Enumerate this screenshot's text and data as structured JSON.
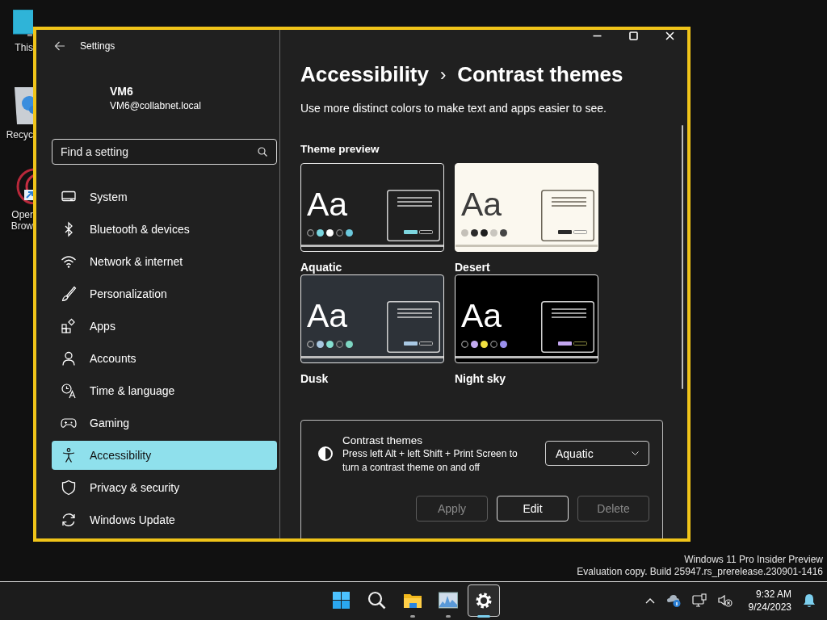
{
  "desktop_icons": [
    {
      "lines": [
        "This"
      ]
    },
    {
      "lines": [
        "Recyc"
      ]
    },
    {
      "lines": [
        "Oper",
        "Brow"
      ]
    }
  ],
  "window": {
    "title": "Settings"
  },
  "account": {
    "name": "VM6",
    "email": "VM6@collabnet.local"
  },
  "search": {
    "placeholder": "Find a setting"
  },
  "nav": [
    {
      "label": "System",
      "selected": false
    },
    {
      "label": "Bluetooth & devices",
      "selected": false
    },
    {
      "label": "Network & internet",
      "selected": false
    },
    {
      "label": "Personalization",
      "selected": false
    },
    {
      "label": "Apps",
      "selected": false
    },
    {
      "label": "Accounts",
      "selected": false
    },
    {
      "label": "Time & language",
      "selected": false
    },
    {
      "label": "Gaming",
      "selected": false
    },
    {
      "label": "Accessibility",
      "selected": true
    },
    {
      "label": "Privacy & security",
      "selected": false
    },
    {
      "label": "Windows Update",
      "selected": false
    }
  ],
  "breadcrumb": {
    "parent": "Accessibility",
    "separator": "›",
    "current": "Contrast themes"
  },
  "description": "Use more distinct colors to make text and apps easier to see.",
  "theme_preview": {
    "heading": "Theme preview",
    "themes": [
      {
        "name": "Aquatic",
        "sample": "Aa",
        "color": "#202020"
      },
      {
        "name": "Desert",
        "sample": "Aa",
        "color": "#fbf8ef"
      },
      {
        "name": "Dusk",
        "sample": "Aa",
        "color": "#2d3238"
      },
      {
        "name": "Night sky",
        "sample": "Aa",
        "color": "#000000"
      }
    ]
  },
  "contrast_setting": {
    "title": "Contrast themes",
    "description": "Press left Alt + left Shift + Print Screen to turn a contrast theme on and off",
    "dropdown": {
      "value": "Aquatic"
    },
    "buttons": [
      {
        "label": "Apply",
        "disabled": true
      },
      {
        "label": "Edit",
        "disabled": false
      },
      {
        "label": "Delete",
        "disabled": true
      }
    ]
  },
  "edition_notice": [
    "Windows 11 Pro Insider Preview",
    "Evaluation copy. Build 25947.rs_prerelease.230901-1416"
  ],
  "taskbar": {
    "apps": [
      {
        "running": false,
        "selected": false
      },
      {
        "running": false,
        "selected": false
      },
      {
        "running": true,
        "selected": false
      },
      {
        "running": true,
        "selected": false
      },
      {
        "running": true,
        "selected": true
      }
    ],
    "clock": {
      "time": "9:32 AM",
      "date": "9/24/2023"
    }
  }
}
